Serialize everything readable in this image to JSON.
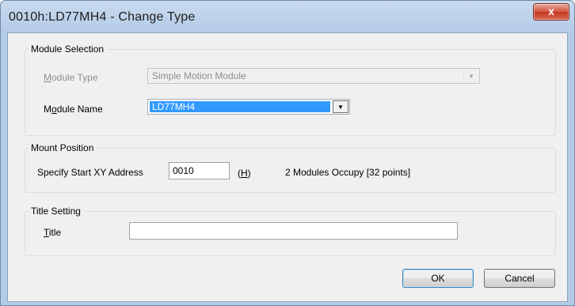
{
  "window": {
    "title": "0010h:LD77MH4 - Change Type",
    "close_glyph": "x"
  },
  "module_selection": {
    "legend": "Module Selection",
    "module_type_label_pre": "",
    "module_type_label_key": "M",
    "module_type_label_post": "odule Type",
    "module_type_value": "Simple Motion Module",
    "module_name_label_pre": "M",
    "module_name_label_key": "o",
    "module_name_label_post": "dule Name",
    "module_name_value": "LD77MH4"
  },
  "mount_position": {
    "legend": "Mount Position",
    "start_xy_label": "Specify Start XY Address",
    "start_xy_value": "0010",
    "hex_pre": "(",
    "hex_key": "H",
    "hex_post": ")",
    "occupy_text": "2 Modules Occupy [32 points]"
  },
  "title_setting": {
    "legend": "Title Setting",
    "title_label_key": "T",
    "title_label_post": "itle",
    "title_value": ""
  },
  "buttons": {
    "ok": "OK",
    "cancel": "Cancel"
  },
  "icons": {
    "dropdown": "dropdown-arrow-icon",
    "close": "close-icon"
  },
  "colors": {
    "selection_highlight": "#3399ff",
    "close_button": "#c3371f"
  }
}
